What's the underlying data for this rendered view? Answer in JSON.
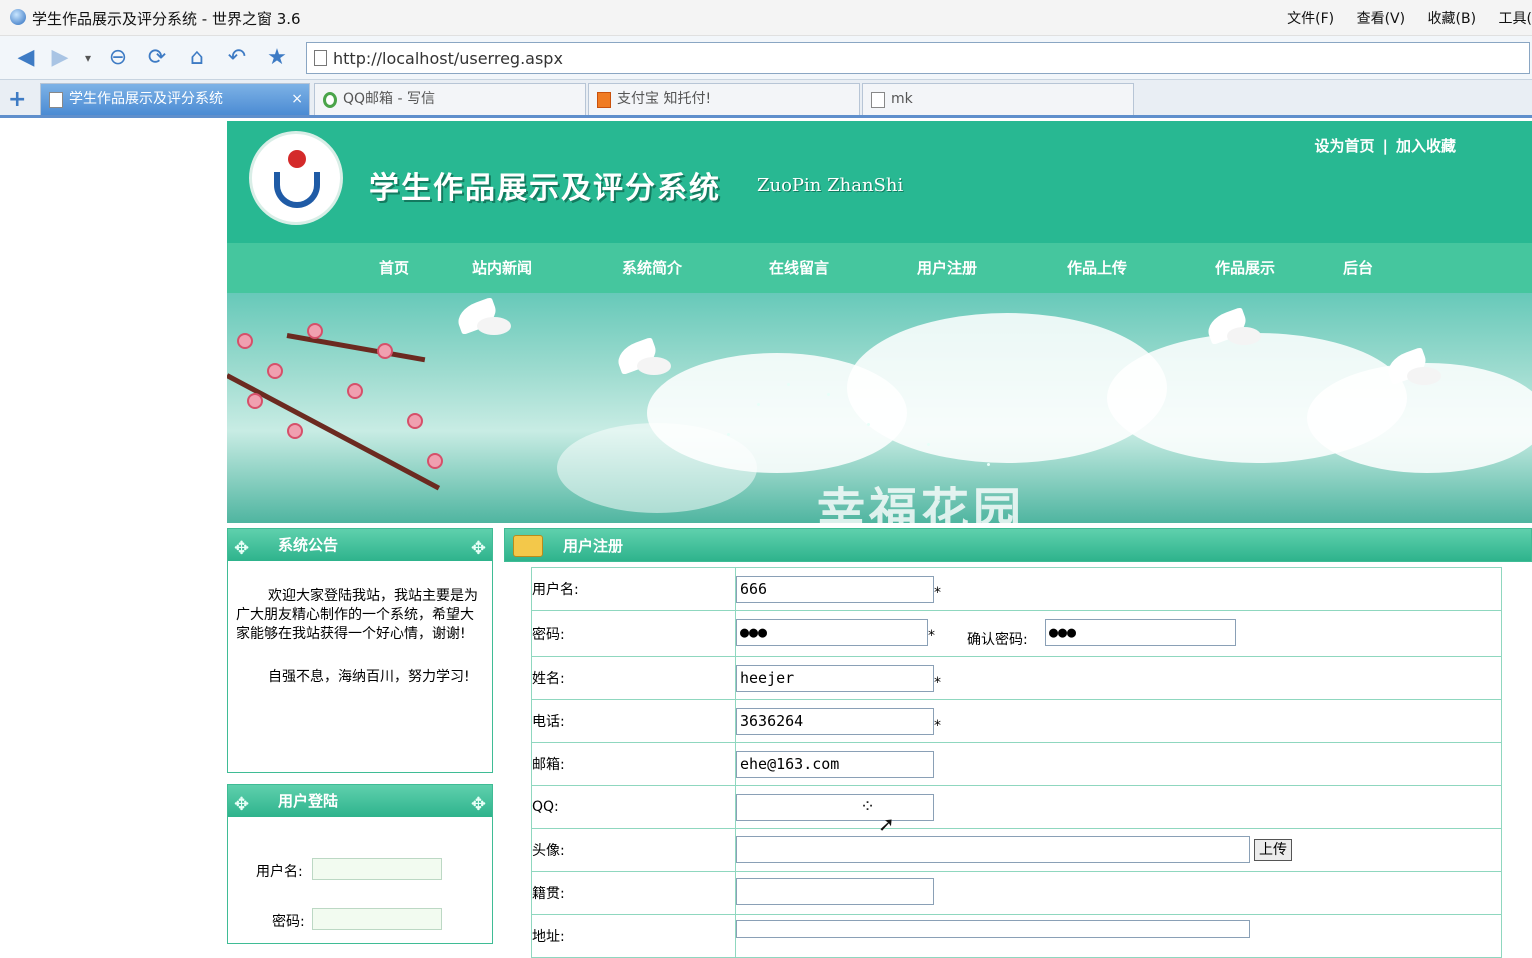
{
  "browser": {
    "title": "学生作品展示及评分系统 - 世界之窗 3.6",
    "menu": [
      "文件(F)",
      "查看(V)",
      "收藏(B)",
      "工具("
    ],
    "url": "http://localhost/userreg.aspx",
    "tabs": [
      {
        "label": "学生作品展示及评分系统",
        "close": "×"
      },
      {
        "label": "QQ邮箱 - 写信"
      },
      {
        "label": "支付宝 知托付!"
      },
      {
        "label": "mk"
      }
    ]
  },
  "site": {
    "title": "学生作品展示及评分系统",
    "subtitle": "ZuoPin ZhanShi",
    "links": {
      "home": "设为首页",
      "sep": "|",
      "fav": "加入收藏"
    },
    "nav": [
      "首页",
      "站内新闻",
      "系统简介",
      "在线留言",
      "用户注册",
      "作品上传",
      "作品展示",
      "后台"
    ],
    "banner_text": "幸福花园"
  },
  "notice": {
    "title": "系统公告",
    "p1": "欢迎大家登陆我站，我站主要是为广大朋友精心制作的一个系统，希望大家能够在我站获得一个好心情，谢谢!",
    "p2": "自强不息，海纳百川，努力学习!"
  },
  "login": {
    "title": "用户登陆",
    "username_label": "用户名:",
    "password_label": "密码:"
  },
  "register": {
    "title": "用户注册",
    "labels": {
      "username": "用户名:",
      "password": "密码:",
      "confirm": "确认密码:",
      "name": "姓名:",
      "phone": "电话:",
      "email": "邮箱:",
      "qq": "QQ:",
      "avatar": "头像:",
      "hometown": "籍贯:",
      "address": "地址:"
    },
    "values": {
      "username": "666",
      "password": "●●●",
      "confirm": "●●●",
      "name": "heejer",
      "phone": "3636264",
      "email": "ehe@163.com",
      "qq": "",
      "avatar": "",
      "hometown": "",
      "address": ""
    },
    "required_mark": "*",
    "upload_button": "上传"
  }
}
